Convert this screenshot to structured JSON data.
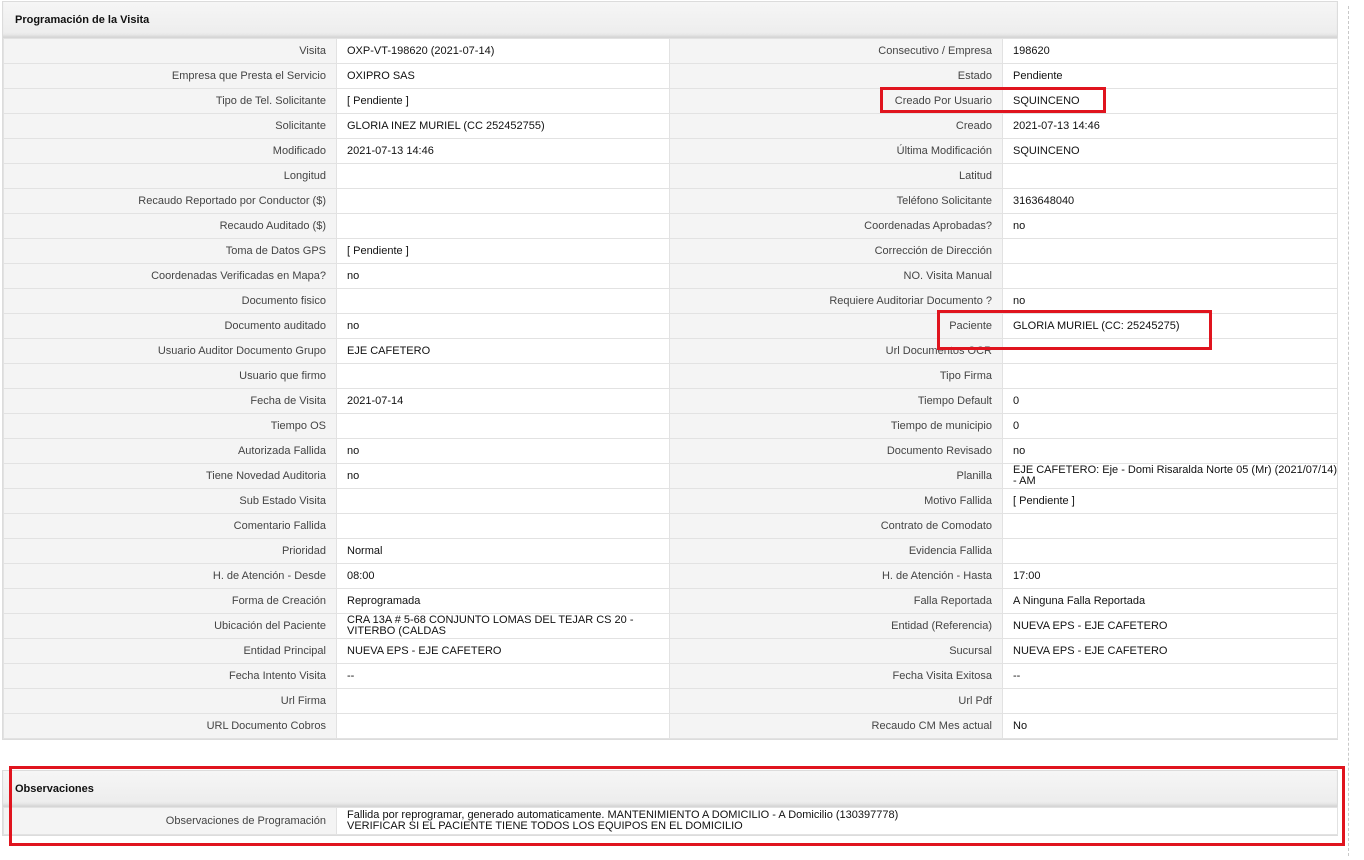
{
  "programacion": {
    "title": "Programación de la Visita",
    "rows": [
      {
        "l1": "Visita",
        "v1": "OXP-VT-198620 (2021-07-14)",
        "l2": "Consecutivo / Empresa",
        "v2": "198620"
      },
      {
        "l1": "Empresa que Presta el Servicio",
        "v1": "OXIPRO SAS",
        "l2": "Estado",
        "v2": "Pendiente"
      },
      {
        "l1": "Tipo de Tel. Solicitante",
        "v1": "[ Pendiente ]",
        "l2": "Creado Por Usuario",
        "v2": "SQUINCENO"
      },
      {
        "l1": "Solicitante",
        "v1": "GLORIA INEZ MURIEL (CC 252452755)",
        "l2": "Creado",
        "v2": "2021-07-13 14:46"
      },
      {
        "l1": "Modificado",
        "v1": "2021-07-13 14:46",
        "l2": "Última Modificación",
        "v2": " SQUINCENO"
      },
      {
        "l1": "Longitud",
        "v1": "",
        "l2": "Latitud",
        "v2": ""
      },
      {
        "l1": "Recaudo Reportado por Conductor ($)",
        "v1": "",
        "l2": "Teléfono Solicitante",
        "v2": "3163648040"
      },
      {
        "l1": "Recaudo Auditado ($)",
        "v1": "",
        "l2": "Coordenadas Aprobadas?",
        "v2": " no"
      },
      {
        "l1": "Toma de Datos GPS",
        "v1": "[ Pendiente ]",
        "l2": "Corrección de Dirección",
        "v2": ""
      },
      {
        "l1": "Coordenadas Verificadas en Mapa?",
        "v1": " no",
        "l2": "NO. Visita Manual",
        "v2": ""
      },
      {
        "l1": "Documento fisico",
        "v1": "",
        "l2": "Requiere Auditoriar Documento ?",
        "v2": " no"
      },
      {
        "l1": "Documento auditado",
        "v1": " no",
        "l2": "Paciente",
        "v2": "GLORIA MURIEL (CC: 25245275)"
      },
      {
        "l1": "Usuario Auditor Documento Grupo",
        "v1": "EJE CAFETERO",
        "l2": "Url Documentos OCR",
        "v2": ""
      },
      {
        "l1": "Usuario que firmo",
        "v1": "",
        "l2": "Tipo Firma",
        "v2": ""
      },
      {
        "l1": "Fecha de Visita",
        "v1": " 2021-07-14",
        "l2": "Tiempo Default",
        "v2": "0"
      },
      {
        "l1": "Tiempo OS",
        "v1": "",
        "l2": "Tiempo de municipio",
        "v2": "0"
      },
      {
        "l1": "Autorizada Fallida",
        "v1": " no",
        "l2": "Documento Revisado",
        "v2": " no"
      },
      {
        "l1": "Tiene Novedad Auditoria",
        "v1": " no",
        "l2": "Planilla",
        "v2": "EJE CAFETERO: Eje - Domi Risaralda Norte 05 (Mr) (2021/07/14) - AM"
      },
      {
        "l1": "Sub Estado Visita",
        "v1": "",
        "l2": "Motivo Fallida",
        "v2": "[ Pendiente ]"
      },
      {
        "l1": "Comentario Fallida",
        "v1": "",
        "l2": "Contrato de Comodato",
        "v2": ""
      },
      {
        "l1": "Prioridad",
        "v1": "Normal",
        "l2": "Evidencia Fallida",
        "v2": ""
      },
      {
        "l1": "H. de Atención - Desde",
        "v1": "08:00",
        "l2": "H. de Atención - Hasta",
        "v2": "17:00"
      },
      {
        "l1": "Forma de Creación",
        "v1": "Reprogramada",
        "l2": "Falla Reportada",
        "v2": "A Ninguna Falla Reportada"
      },
      {
        "l1": "Ubicación del Paciente",
        "v1": "CRA 13A # 5-68 CONJUNTO LOMAS DEL TEJAR CS 20 - VITERBO (CALDAS",
        "l2": "Entidad (Referencia)",
        "v2": "NUEVA EPS - EJE CAFETERO"
      },
      {
        "l1": "Entidad Principal",
        "v1": "NUEVA EPS - EJE CAFETERO",
        "l2": "Sucursal",
        "v2": "NUEVA EPS - EJE CAFETERO"
      },
      {
        "l1": "Fecha Intento Visita",
        "v1": " --",
        "l2": "Fecha Visita Exitosa",
        "v2": " --"
      },
      {
        "l1": "Url Firma",
        "v1": "",
        "l2": "Url Pdf",
        "v2": ""
      },
      {
        "l1": "URL Documento Cobros",
        "v1": "",
        "l2": "Recaudo CM Mes actual",
        "v2": "No"
      }
    ]
  },
  "observaciones": {
    "title": "Observaciones",
    "label": "Observaciones de Programación",
    "line1": "Fallida por reprogramar, generado automaticamente. MANTENIMIENTO A DOMICILIO - A Domicilio (130397778)",
    "line2": "VERIFICAR SI EL PACIENTE TIENE TODOS LOS EQUIPOS EN EL DOMICILIO"
  },
  "colors": {
    "highlight": "#e0141e",
    "label_bg": "#f4f4f4",
    "header_bg": "#ececec"
  }
}
